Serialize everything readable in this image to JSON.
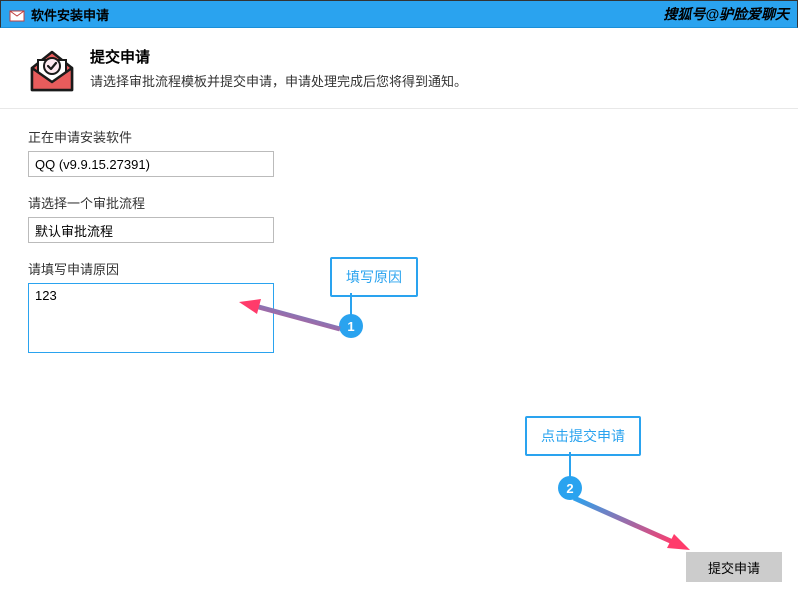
{
  "titlebar": {
    "title": "软件安装申请",
    "watermark": "搜狐号@驴脸爱聊天"
  },
  "header": {
    "title": "提交申请",
    "subtitle": "请选择审批流程模板并提交申请，申请处理完成后您将得到通知。"
  },
  "form": {
    "software_label": "正在申请安装软件",
    "software_value": "QQ (v9.9.15.27391)",
    "flow_label": "请选择一个审批流程",
    "flow_value": "默认审批流程",
    "reason_label": "请填写申请原因",
    "reason_value": "123"
  },
  "buttons": {
    "submit": "提交申请"
  },
  "annotations": {
    "callout1": "填写原因",
    "bubble1": "1",
    "callout2": "点击提交申请",
    "bubble2": "2"
  }
}
